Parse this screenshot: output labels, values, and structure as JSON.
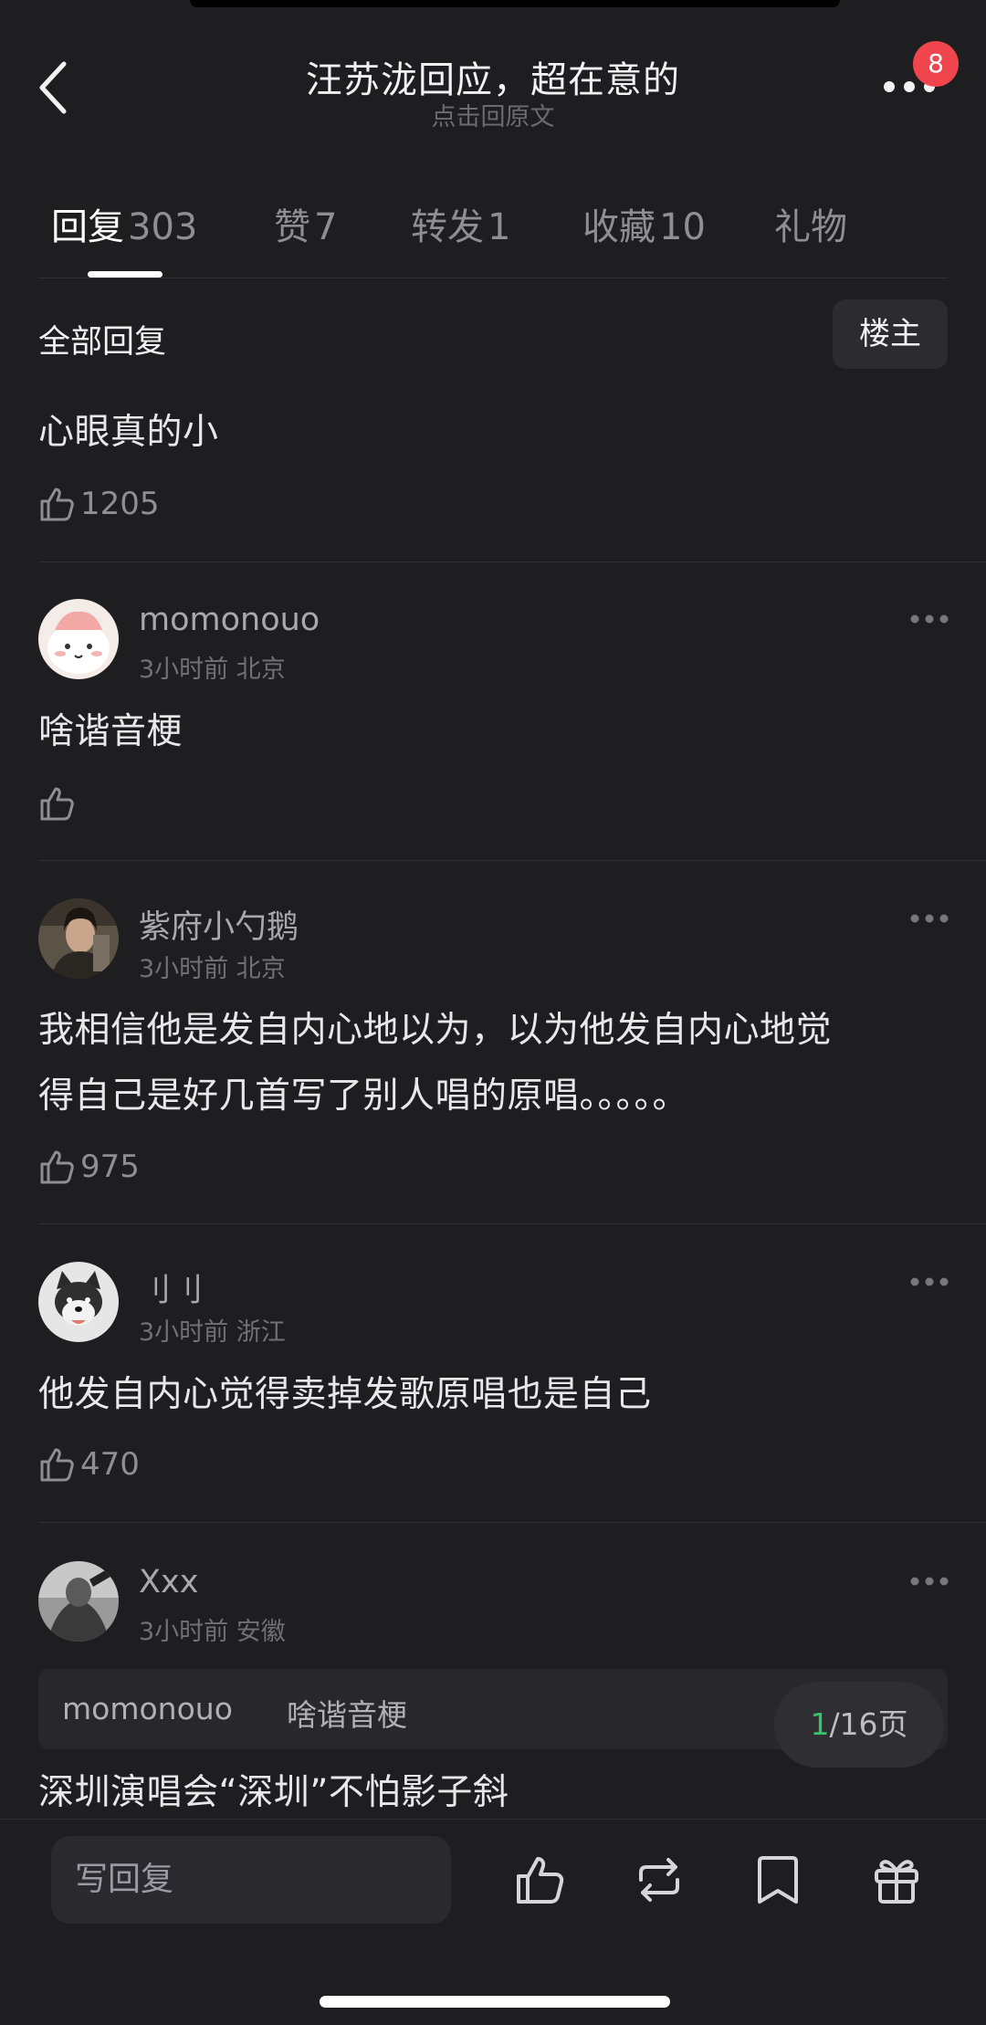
{
  "header": {
    "title": "汪苏泷回应，超在意的",
    "subtitle": "点击回原文",
    "badge_count": "8"
  },
  "tabs": [
    {
      "label": "回复",
      "count": "303",
      "active": true
    },
    {
      "label": "赞",
      "count": "7"
    },
    {
      "label": "转发",
      "count": "1"
    },
    {
      "label": "收藏",
      "count": "10"
    },
    {
      "label": "礼物",
      "count": ""
    }
  ],
  "filter": {
    "all_label": "全部回复",
    "op_label": "楼主"
  },
  "top_reply": {
    "text": "心眼真的小",
    "likes": "1205"
  },
  "comments": [
    {
      "username": "momonouo",
      "time": "3小时前",
      "location": "北京",
      "lines": [
        "啥谐音梗"
      ],
      "likes": ""
    },
    {
      "username": "紫府小勺鹅",
      "time": "3小时前",
      "location": "北京",
      "lines": [
        "我相信他是发自内心地以为，以为他发自内心地觉",
        "得自己是好几首写了别人唱的原唱。。。。。"
      ],
      "likes": "975"
    },
    {
      "username": "刂刂",
      "time": "3小时前",
      "location": "浙江",
      "lines": [
        "他发自内心觉得卖掉发歌原唱也是自己"
      ],
      "likes": "470"
    },
    {
      "username": "Xxx",
      "time": "3小时前",
      "location": "安徽",
      "quote_user": "momonouo",
      "quote_text": "啥谐音梗",
      "lines": [
        "深圳演唱会“深圳”不怕影子斜"
      ]
    }
  ],
  "pager": {
    "current": "1",
    "total_text": "/16页"
  },
  "bottom_bar": {
    "reply_placeholder": "写回复"
  },
  "colors": {
    "background": "#1e1e21",
    "badge": "#f0454d",
    "pager_current": "#36c36a"
  },
  "icons": [
    "back-arrow-icon",
    "more-dots-icon",
    "thumbs-up-icon",
    "repost-icon",
    "bookmark-icon",
    "gift-icon"
  ]
}
